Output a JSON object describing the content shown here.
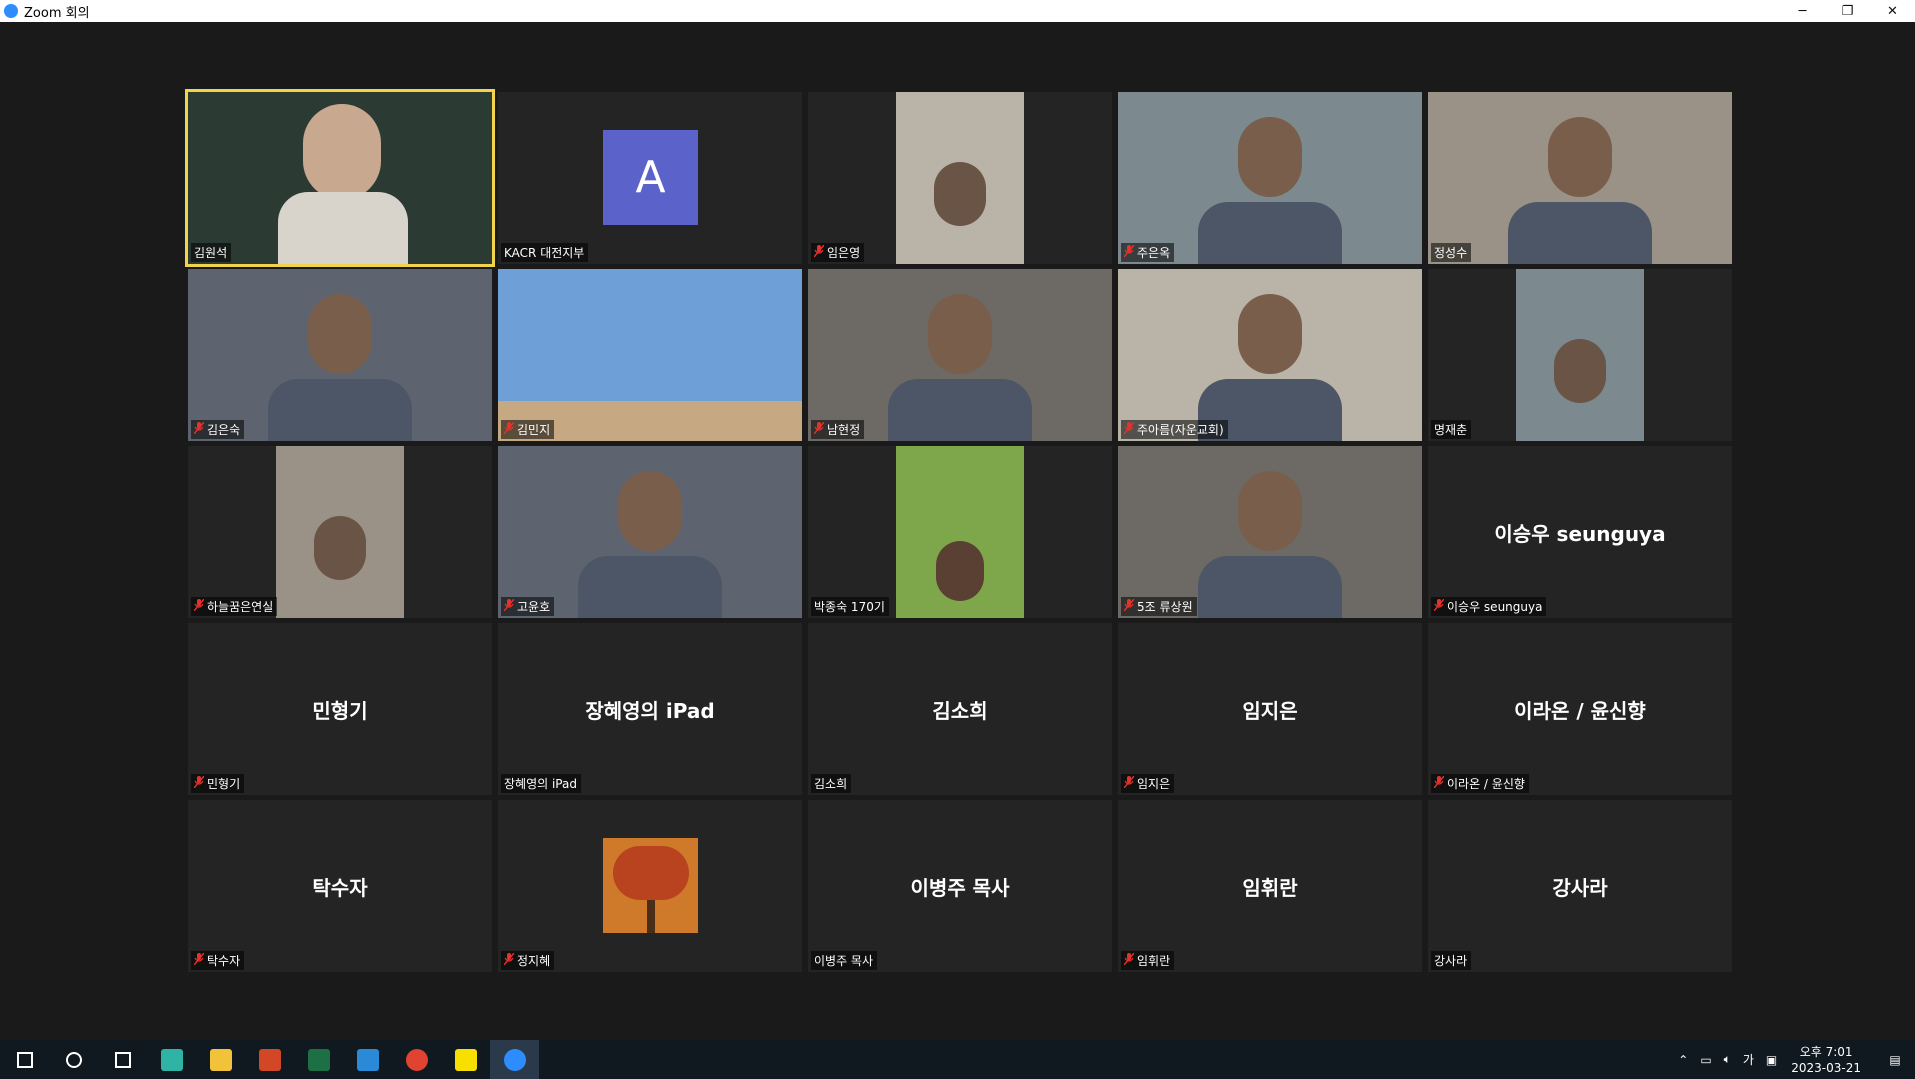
{
  "window": {
    "title": "Zoom 회의",
    "minimize": "─",
    "restore": "❐",
    "close": "✕"
  },
  "participants": [
    {
      "name": "김원석",
      "muted": false,
      "display": "video-teacher",
      "active": true
    },
    {
      "name": "KACR 대전지부",
      "muted": false,
      "display": "avatar",
      "avatar_letter": "A",
      "avatar_color": "#5b62c9"
    },
    {
      "name": "임은영",
      "muted": true,
      "display": "video-narrow"
    },
    {
      "name": "주은옥",
      "muted": true,
      "display": "video"
    },
    {
      "name": "정성수",
      "muted": false,
      "display": "video"
    },
    {
      "name": "김은숙",
      "muted": true,
      "display": "video"
    },
    {
      "name": "김민지",
      "muted": true,
      "display": "video-sky"
    },
    {
      "name": "남현정",
      "muted": true,
      "display": "video"
    },
    {
      "name": "주아름(자운교회)",
      "muted": true,
      "display": "video"
    },
    {
      "name": "명재춘",
      "muted": false,
      "display": "video-narrow"
    },
    {
      "name": "하늘꿈은연실",
      "muted": true,
      "display": "video-narrow"
    },
    {
      "name": "고윤호",
      "muted": true,
      "display": "video"
    },
    {
      "name": "박종숙 170기",
      "muted": false,
      "display": "video-narrow-green"
    },
    {
      "name": "5조 류상원",
      "muted": true,
      "display": "video"
    },
    {
      "name": "이승우 seunguya",
      "muted": true,
      "display": "name"
    },
    {
      "name": "민형기",
      "muted": true,
      "display": "name"
    },
    {
      "name": "장혜영의 iPad",
      "muted": false,
      "display": "name"
    },
    {
      "name": "김소희",
      "muted": false,
      "display": "name"
    },
    {
      "name": "임지은",
      "muted": true,
      "display": "name"
    },
    {
      "name": "이라온 / 윤신향",
      "muted": true,
      "display": "name"
    },
    {
      "name": "탁수자",
      "muted": true,
      "display": "name"
    },
    {
      "name": "정지혜",
      "muted": true,
      "display": "picture-tree"
    },
    {
      "name": "이병주 목사",
      "muted": false,
      "display": "name"
    },
    {
      "name": "임휘란",
      "muted": true,
      "display": "name"
    },
    {
      "name": "강사라",
      "muted": false,
      "display": "name"
    }
  ],
  "taskbar": {
    "apps": [
      "start-icon",
      "search-icon",
      "task-view-icon",
      "edge-icon",
      "file-explorer-icon",
      "powerpoint-icon",
      "excel-icon",
      "app-icon",
      "chrome-icon",
      "kakaotalk-icon",
      "zoom-icon"
    ],
    "ime": "가",
    "time": "오후 7:01",
    "date": "2023-03-21"
  },
  "colors": {
    "active_speaker": "#f2d44a",
    "mute": "#e5322d",
    "tile_bg": "#242424"
  }
}
